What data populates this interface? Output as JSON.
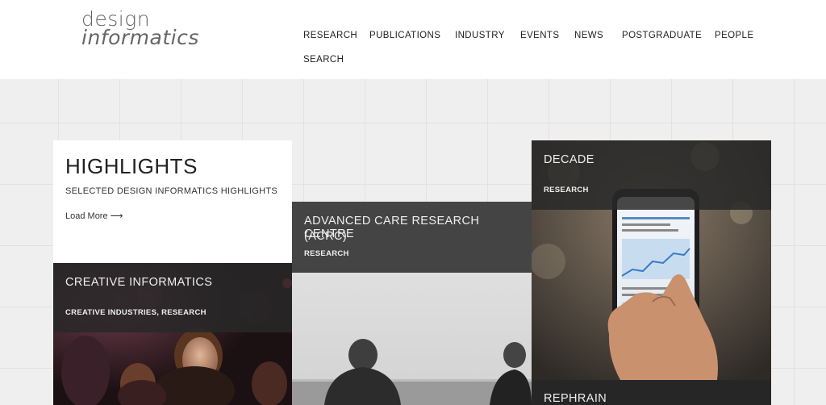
{
  "logo": {
    "line1": "design",
    "line2": "informatics"
  },
  "nav": [
    "RESEARCH",
    "PUBLICATIONS",
    "INDUSTRY",
    "EVENTS",
    "NEWS",
    "POSTGRADUATE",
    "PEOPLE",
    "SEARCH"
  ],
  "highlights": {
    "title": "HIGHLIGHTS",
    "subtitle": "SELECTED DESIGN INFORMATICS HIGHLIGHTS",
    "load_more": "Load More ⟶"
  },
  "cards": {
    "creative": {
      "title": "CREATIVE INFORMATICS",
      "tags": "CREATIVE INDUSTRIES, RESEARCH"
    },
    "acrc": {
      "title_line1": "ADVANCED CARE RESEARCH CENTRE",
      "title_line2": "(ACRC)",
      "tags": "RESEARCH"
    },
    "decade": {
      "title": "DECADE",
      "tags": "RESEARCH"
    },
    "rephrain": {
      "title": "REPHRAIN"
    }
  },
  "colors": {
    "grid_bg": "#efefef",
    "overlay": "#282828"
  }
}
